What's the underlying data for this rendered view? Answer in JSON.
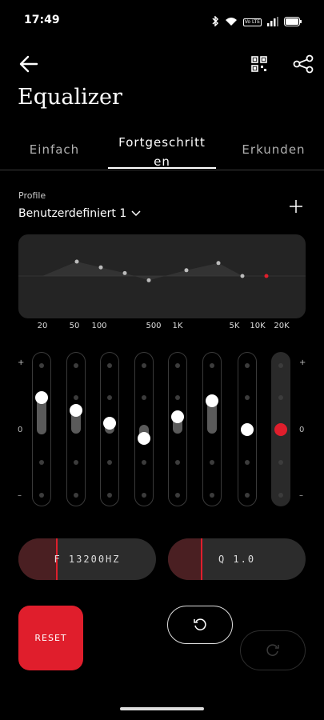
{
  "status": {
    "time": "17:49",
    "icons": [
      "bluetooth-icon",
      "wifi-icon",
      "volte-icon",
      "signal-icon",
      "battery-icon"
    ],
    "volte_label": "Vo LTE"
  },
  "header": {
    "title": "Equalizer",
    "icons": [
      "back-arrow-icon",
      "qr-code-icon",
      "share-icon"
    ]
  },
  "tabs": [
    {
      "label": "Einfach",
      "active": false
    },
    {
      "label": "Fortgeschritt en",
      "active": true
    },
    {
      "label": "Erkunden",
      "active": false
    }
  ],
  "profile": {
    "label": "Profile",
    "value": "Benutzerdefiniert 1",
    "add_icon": "plus-icon"
  },
  "eq": {
    "frequency_labels": [
      "20",
      "50",
      "100",
      "500",
      "1K",
      "5K",
      "10K",
      "20K"
    ],
    "scale": {
      "plus": "+",
      "zero": "0",
      "minus": "–"
    },
    "band_levels": [
      0.5,
      0.3,
      0.1,
      -0.15,
      0.2,
      0.45,
      0.0,
      0.0
    ],
    "selected_band": 7,
    "accent_color": "#e01e2c"
  },
  "params": {
    "frequency": {
      "text": "F  13200HZ"
    },
    "q": {
      "text": "Q  1.0"
    }
  },
  "buttons": {
    "reset": "RESET",
    "undo_icon": "undo-icon",
    "redo_icon": "redo-icon"
  }
}
